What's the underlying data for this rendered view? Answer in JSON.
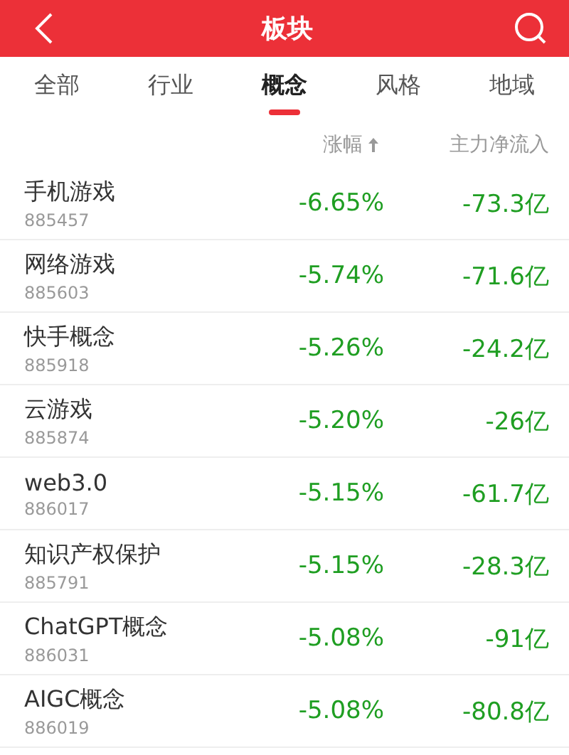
{
  "header": {
    "title": "板块"
  },
  "tabs": [
    {
      "label": "全部",
      "selected": false
    },
    {
      "label": "行业",
      "selected": false
    },
    {
      "label": "概念",
      "selected": true
    },
    {
      "label": "风格",
      "selected": false
    },
    {
      "label": "地域",
      "selected": false
    }
  ],
  "columns": [
    {
      "label": "涨幅",
      "sorted": true
    },
    {
      "label": "主力净流入",
      "sorted": false
    }
  ],
  "rows": [
    {
      "name": "手机游戏",
      "code": "885457",
      "change": "-6.65%",
      "inflow": "-73.3亿"
    },
    {
      "name": "网络游戏",
      "code": "885603",
      "change": "-5.74%",
      "inflow": "-71.6亿"
    },
    {
      "name": "快手概念",
      "code": "885918",
      "change": "-5.26%",
      "inflow": "-24.2亿"
    },
    {
      "name": "云游戏",
      "code": "885874",
      "change": "-5.20%",
      "inflow": "-26亿"
    },
    {
      "name": "web3.0",
      "code": "886017",
      "change": "-5.15%",
      "inflow": "-61.7亿"
    },
    {
      "name": "知识产权保护",
      "code": "885791",
      "change": "-5.15%",
      "inflow": "-28.3亿"
    },
    {
      "name": "ChatGPT概念",
      "code": "886031",
      "change": "-5.08%",
      "inflow": "-91亿"
    },
    {
      "name": "AIGC概念",
      "code": "886019",
      "change": "-5.08%",
      "inflow": "-80.8亿"
    }
  ]
}
